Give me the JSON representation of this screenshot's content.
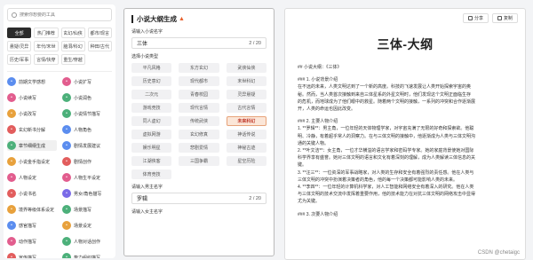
{
  "search": {
    "placeholder": "搜索你想要的工具"
  },
  "categories": [
    "全部",
    "热门推荐",
    "玄幻/仙侠",
    "都市/现言",
    "悬疑/灵异",
    "年代/末世",
    "脑洞/科幻",
    "种田/古代",
    "历史/军事",
    "言情/快穿",
    "重生/穿越",
    ""
  ],
  "tools": [
    {
      "label": "前期文学感想",
      "color": "#5b8def",
      "icon": "doc-icon"
    },
    {
      "label": "小说扩写",
      "color": "#e25d8e",
      "icon": "expand-icon"
    },
    {
      "label": "小说续写",
      "color": "#e25d8e",
      "icon": "pen-icon"
    },
    {
      "label": "小说润色",
      "color": "#4cb07a",
      "icon": "brush-icon"
    },
    {
      "label": "小说改写",
      "color": "#e8a13c",
      "icon": "edit-icon"
    },
    {
      "label": "小说情节描写",
      "color": "#4cb07a",
      "icon": "scene-icon"
    },
    {
      "label": "玄幻新书分解",
      "color": "#e25d5d",
      "icon": "book-icon"
    },
    {
      "label": "人物角色",
      "color": "#5b8def",
      "icon": "person-icon"
    },
    {
      "label": "章节细纲生成",
      "color": "#4cb07a",
      "icon": "outline-icon"
    },
    {
      "label": "剧情发展建议",
      "color": "#5b8def",
      "icon": "plot-icon"
    },
    {
      "label": "小说金手指设定",
      "color": "#e8a13c",
      "icon": "finger-icon"
    },
    {
      "label": "剧情创作",
      "color": "#e25d5d",
      "icon": "create-icon"
    },
    {
      "label": "人物设定",
      "color": "#e25d8e",
      "icon": "char-icon"
    },
    {
      "label": "人物生平设定",
      "color": "#e25d8e",
      "icon": "life-icon"
    },
    {
      "label": "小说书名",
      "color": "#e25d5d",
      "icon": "title-icon"
    },
    {
      "label": "男女/角色描写",
      "color": "#7a6be8",
      "icon": "gender-icon"
    },
    {
      "label": "境界等级体系设定",
      "color": "#e8a13c",
      "icon": "level-icon"
    },
    {
      "label": "场景描写",
      "color": "#4cb07a",
      "icon": "scene2-icon"
    },
    {
      "label": "感官描写",
      "color": "#5b8def",
      "icon": "sense-icon"
    },
    {
      "label": "场景设定",
      "color": "#e8a13c",
      "icon": "setting-icon"
    },
    {
      "label": "动作描写",
      "color": "#e25d8e",
      "icon": "action-icon"
    },
    {
      "label": "人物对话创作",
      "color": "#4cb07a",
      "icon": "dialog-icon"
    },
    {
      "label": "宣传描写",
      "color": "#e25d5d",
      "icon": "promo-icon"
    },
    {
      "label": "势力组织描写",
      "color": "#4cb07a",
      "icon": "org-icon"
    }
  ],
  "middle": {
    "title": "小说大纲生成",
    "name_label": "请输入小说名字",
    "name_value": "三体",
    "name_count": "2 / 20",
    "type_label": "选择小说类型",
    "types": [
      "平凡风格",
      "东方玄幻",
      "武侠仙侠",
      "历史意幻",
      "现代都市",
      "末世科幻",
      "二次元",
      "青春校园",
      "灵异悬疑",
      "游戏竞技",
      "现代言情",
      "古代言情",
      "同人虚幻",
      "传统武侠",
      "未来科幻",
      "虚拟网游",
      "玄幻修真",
      "神话传说",
      "娱乐明星",
      "悲剧爱情",
      "神秘古迹",
      "江湖侠客",
      "三国争霸",
      "星空历险",
      "体育竞技"
    ],
    "active_type": "未来科幻",
    "male_label": "请输入男主名字",
    "male_value": "罗辑",
    "male_count": "2 / 20",
    "female_label": "请输入女主名字"
  },
  "right": {
    "share_label": "分享",
    "copy_label": "复制",
    "doc_title": "三体-大纲",
    "lines": [
      "## 小说大纲：《三体》",
      "",
      "### 1. 小说背景介绍",
      "在不远的未来，人类文明达到了一个新的高度。科技的飞速发展让人类开始探索宇宙的奥",
      "秘。然而，当人类首次接触到来自三体星系的外星文明时，他们发现这个文明正面临生存",
      "的危机，而地球成为了他们眼中的救星。随着两个文明的接触，一系列的冲突和合作逐渐展",
      "开，人类的命运也因此改变。",
      "",
      "### 2. 主要人物介绍",
      "1. **罗辑**：男主角，一位年轻的天体物理学家，对宇宙充满了无限的好奇和探索欲。他聪",
      "明、冷静，有着超乎常人的洞察力。在与三体文明的接触中，他逐渐成为人类与三体文明沟",
      "通的关键人物。",
      "2. **叶文洁**：女主角，一位才华横溢的语言学家和密码学专家。她的家庭背景使她对国际",
      "科学界享有盛誉。她对三体文明的语言和文化有着深刻的理解，成为人类解读三体信息的关",
      "键。",
      "3. **汪三**：一位资深的军事战略家，对人类的生存和安全有着强烈的责任感。他在人类与",
      "三体文明的冲突中扮演着决策者的角色，他的每一个决策都可能影响人类的未来。",
      "4. **李四**：一位年轻的计算机科学家，对人工智能和网络安全有着深入的研究。他在人类",
      "与三体文明的技术交流中发挥着重要作用，他的技术能力在对抗三体文明的网络攻击中显得",
      "尤为关键。",
      "",
      "### 3. 次要人物介绍"
    ]
  },
  "watermark": "CSDN @chetaigc"
}
